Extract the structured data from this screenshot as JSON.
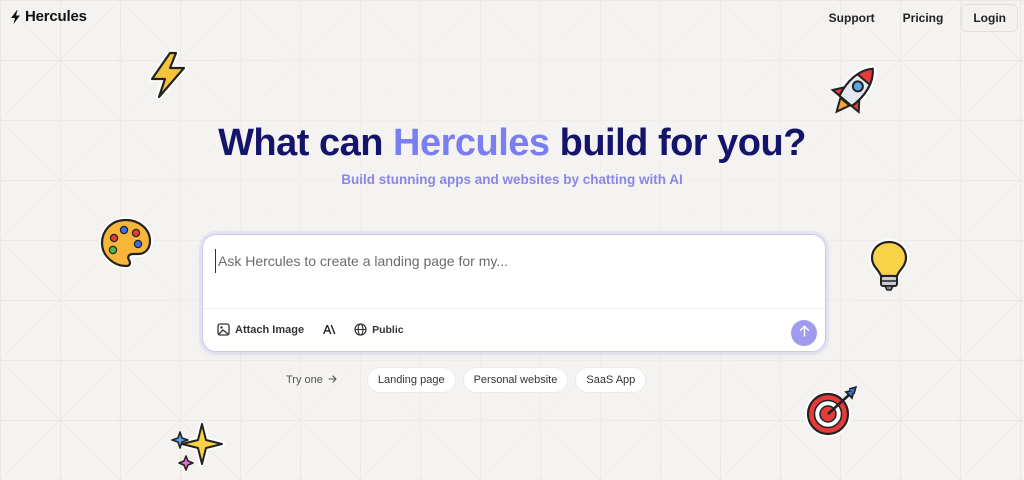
{
  "brand": {
    "name": "Hercules",
    "icon": "lightning-bolt-icon"
  },
  "nav": {
    "links": [
      "Support",
      "Pricing"
    ],
    "login_label": "Login"
  },
  "hero": {
    "headline_pre": "What can ",
    "headline_accent": "Hercules",
    "headline_post": " build for you?",
    "subtitle": "Build stunning apps and websites by chatting with AI"
  },
  "prompt": {
    "placeholder": "Ask Hercules to create a landing page for my...",
    "value": "",
    "tools": {
      "attach_label": "Attach Image",
      "attach_icon": "image-icon",
      "model_icon": "anthropic-icon",
      "visibility_label": "Public",
      "visibility_icon": "globe-icon"
    },
    "send_icon": "arrow-up-icon"
  },
  "suggestions": {
    "try_label": "Try one",
    "chips": [
      "Landing page",
      "Personal website",
      "SaaS App"
    ]
  },
  "stickers": [
    "lightning-icon",
    "rocket-icon",
    "palette-icon",
    "lightbulb-icon",
    "target-icon",
    "sparkles-icon"
  ],
  "colors": {
    "headline": "#14146b",
    "accent": "#7b7ef0",
    "subtitle": "#8a86e6",
    "send_button": "#9f9cf0",
    "background": "#f4f3f1"
  }
}
